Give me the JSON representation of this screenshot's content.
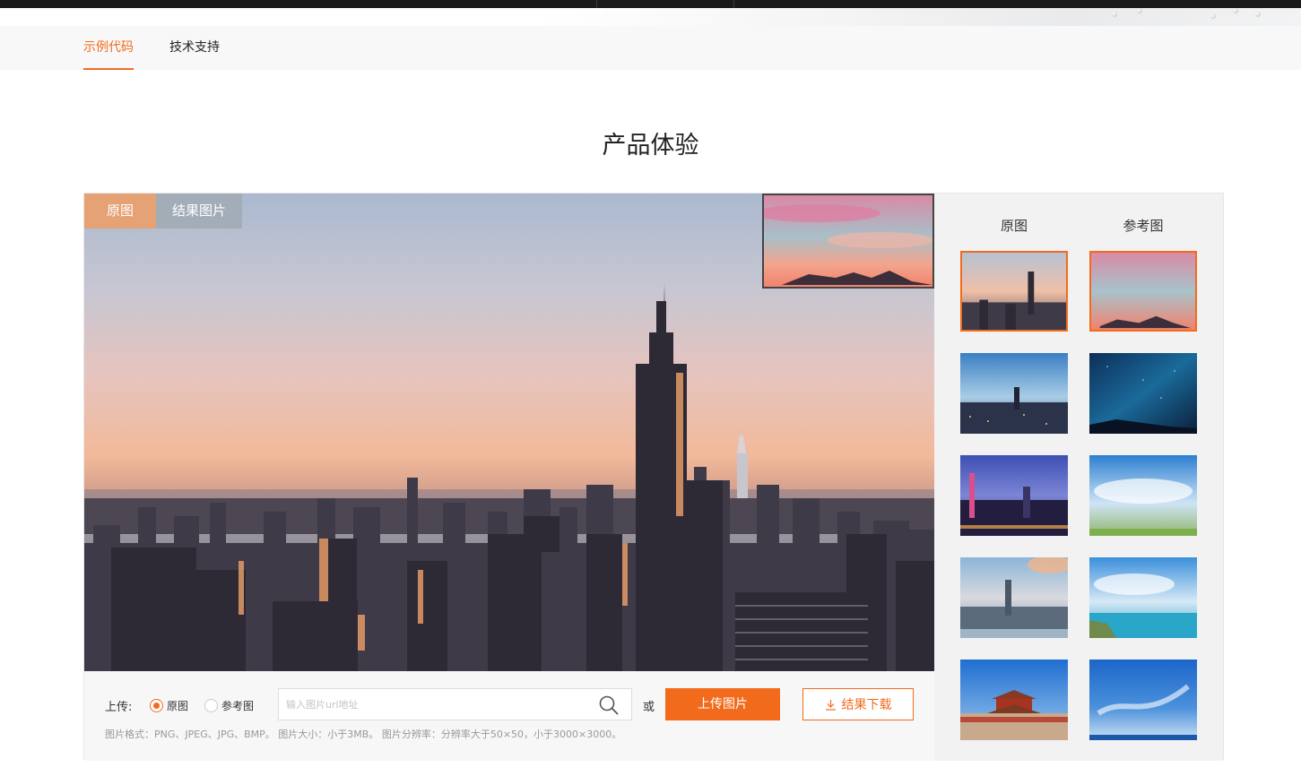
{
  "tabs": [
    {
      "label": "示例代码",
      "active": true
    },
    {
      "label": "技术支持",
      "active": false
    }
  ],
  "section_title": "产品体验",
  "viewer": {
    "tab_original": "原图",
    "tab_result": "结果图片"
  },
  "controls": {
    "upload_label": "上传:",
    "radio_original": "原图",
    "radio_reference": "参考图",
    "url_placeholder": "输入图片url地址",
    "or_text": "或",
    "upload_button": "上传图片",
    "download_button": "结果下载",
    "hint": "图片格式：PNG、JPEG、JPG、BMP。 图片大小：小于3MB。 图片分辨率：分辨率大于50×50，小于3000×3000。"
  },
  "side": {
    "header_original": "原图",
    "header_reference": "参考图"
  },
  "colors": {
    "accent": "#f26b1d",
    "tab_original_bg": "#e4a275",
    "side_bg": "#f2f2f2"
  }
}
